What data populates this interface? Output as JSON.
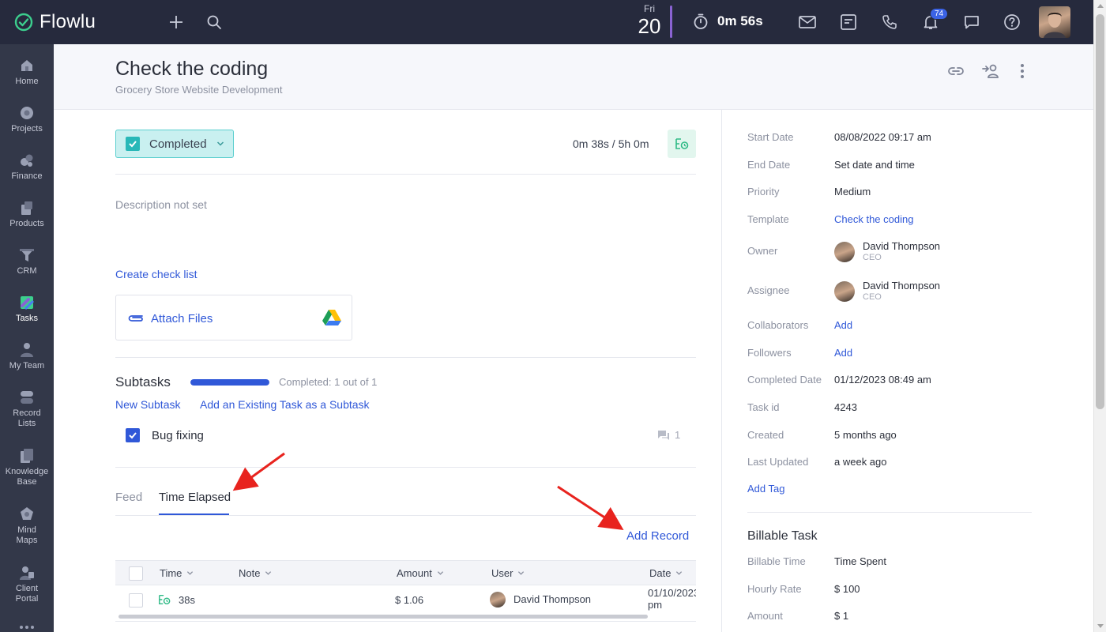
{
  "app": {
    "name": "Flowlu"
  },
  "topbar": {
    "date_dow": "Fri",
    "date_day": "20",
    "timer": "0m 56s",
    "notifications_count": "74"
  },
  "sidebar": {
    "items": [
      {
        "label": "Home",
        "icon": "home-icon"
      },
      {
        "label": "Projects",
        "icon": "projects-icon"
      },
      {
        "label": "Finance",
        "icon": "finance-icon"
      },
      {
        "label": "Products",
        "icon": "products-icon"
      },
      {
        "label": "CRM",
        "icon": "crm-funnel-icon"
      },
      {
        "label": "Tasks",
        "icon": "tasks-icon",
        "active": true
      },
      {
        "label": "My Team",
        "icon": "team-icon"
      },
      {
        "label": "Record\nLists",
        "label_line1": "Record",
        "label_line2": "Lists",
        "icon": "record-lists-icon"
      },
      {
        "label_line1": "Knowledge",
        "label_line2": "Base",
        "icon": "knowledge-base-icon"
      },
      {
        "label_line1": "Mind",
        "label_line2": "Maps",
        "icon": "mind-maps-icon"
      },
      {
        "label_line1": "Client",
        "label_line2": "Portal",
        "icon": "client-portal-icon"
      }
    ]
  },
  "header": {
    "title": "Check the coding",
    "subtitle": "Grocery Store Website Development"
  },
  "task": {
    "status": "Completed",
    "time_summary": "0m 38s / 5h 0m",
    "description_placeholder": "Description not set",
    "create_checklist": "Create check list",
    "attach_files": "Attach Files"
  },
  "subtasks": {
    "title": "Subtasks",
    "progress_fraction": 1.0,
    "progress_text": "Completed: 1 out of 1",
    "new_subtask": "New Subtask",
    "add_existing": "Add an Existing Task as a Subtask",
    "items": [
      {
        "name": "Bug fixing",
        "comments": "1",
        "done": true
      }
    ]
  },
  "tabs": {
    "feed": "Feed",
    "time_elapsed": "Time Elapsed",
    "active": "time_elapsed"
  },
  "time_records": {
    "add_record": "Add Record",
    "columns": [
      "Time",
      "Note",
      "Amount",
      "User",
      "Date"
    ],
    "rows": [
      {
        "time": "38s",
        "note": "",
        "amount": "$ 1.06",
        "user": "David Thompson",
        "date_line1": "01/10/2023",
        "date_line2": "pm"
      }
    ]
  },
  "properties": {
    "start_date": {
      "label": "Start Date",
      "value": "08/08/2022 09:17 am"
    },
    "end_date": {
      "label": "End Date",
      "value": "Set date and time"
    },
    "priority": {
      "label": "Priority",
      "value": "Medium"
    },
    "template": {
      "label": "Template",
      "value": "Check the coding"
    },
    "owner": {
      "label": "Owner",
      "name": "David Thompson",
      "role": "CEO"
    },
    "assignee": {
      "label": "Assignee",
      "name": "David Thompson",
      "role": "CEO"
    },
    "collaborators": {
      "label": "Collaborators",
      "value": "Add"
    },
    "followers": {
      "label": "Followers",
      "value": "Add"
    },
    "completed_date": {
      "label": "Completed Date",
      "value": "01/12/2023 08:49 am"
    },
    "task_id": {
      "label": "Task id",
      "value": "4243"
    },
    "created": {
      "label": "Created",
      "value": "5 months ago"
    },
    "last_updated": {
      "label": "Last Updated",
      "value": "a week ago"
    },
    "add_tag": "Add Tag"
  },
  "billable": {
    "title": "Billable Task",
    "billable_time": {
      "label": "Billable Time",
      "value": "Time Spent"
    },
    "hourly_rate": {
      "label": "Hourly Rate",
      "value": "$ 100"
    },
    "amount": {
      "label": "Amount",
      "value": "$ 1"
    }
  },
  "colors": {
    "topbar_bg": "#262a3d",
    "sidebar_bg": "#333849",
    "link": "#3058d8",
    "status_bg": "#c9f0f0",
    "status_border": "#5ccfcf",
    "annotation": "#e8231e"
  }
}
